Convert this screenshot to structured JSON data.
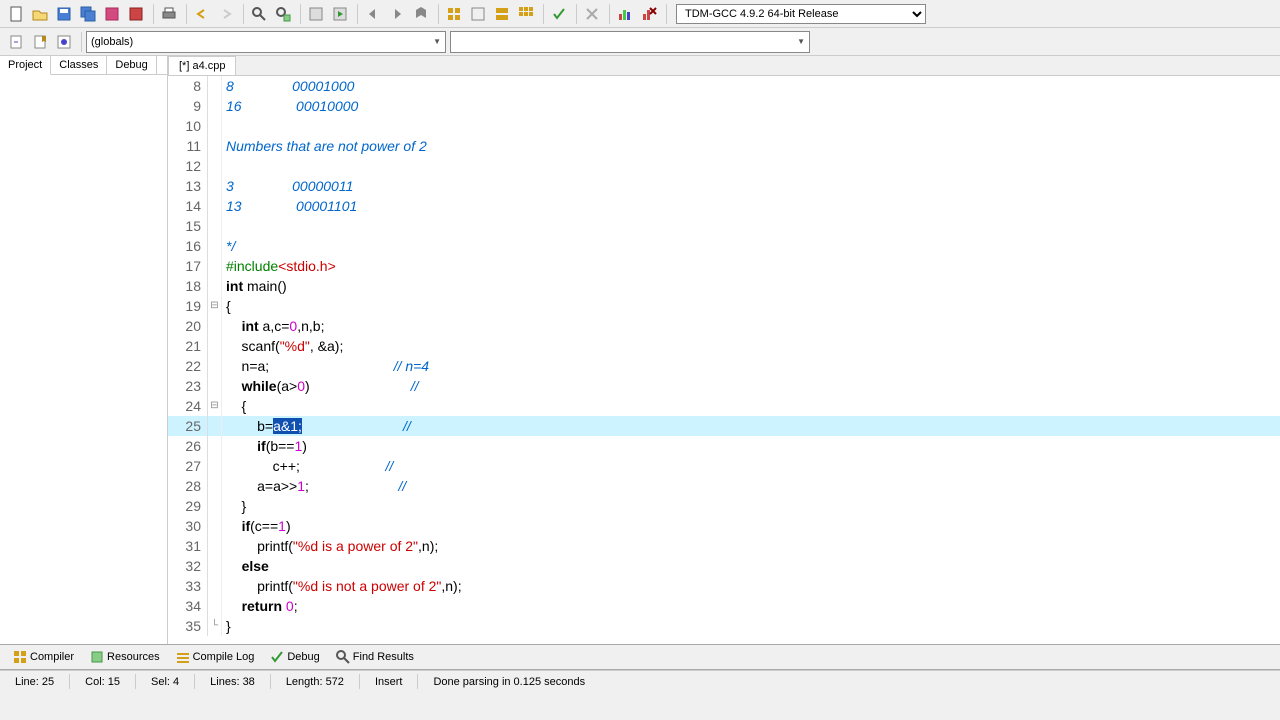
{
  "compiler_dropdown": "TDM-GCC 4.9.2 64-bit Release",
  "scope_dropdown": "(globals)",
  "side_tabs": {
    "project": "Project",
    "classes": "Classes",
    "debug": "Debug"
  },
  "file_tab": "[*] a4.cpp",
  "code_lines": [
    {
      "n": 8,
      "html": "<span class='cmt'>8               00001000</span>"
    },
    {
      "n": 9,
      "html": "<span class='cmt'>16              00010000</span>"
    },
    {
      "n": 10,
      "html": ""
    },
    {
      "n": 11,
      "html": "<span class='cmt'>Numbers that are not power of 2</span>"
    },
    {
      "n": 12,
      "html": ""
    },
    {
      "n": 13,
      "html": "<span class='cmt'>3               00000011</span>"
    },
    {
      "n": 14,
      "html": "<span class='cmt'>13              00001101</span>"
    },
    {
      "n": 15,
      "html": ""
    },
    {
      "n": 16,
      "html": "<span class='cmt'>*/</span>"
    },
    {
      "n": 17,
      "html": "<span class='pp'>#include</span><span class='str'>&lt;stdio.h&gt;</span>"
    },
    {
      "n": 18,
      "html": "<span class='kw'>int</span> <span class='fn'>main</span>()"
    },
    {
      "n": 19,
      "html": "{",
      "fold": "⊟"
    },
    {
      "n": 20,
      "html": "    <span class='kw'>int</span> a,c=<span class='num'>0</span>,n,b;"
    },
    {
      "n": 21,
      "html": "    scanf(<span class='str'>\"%d\"</span>, &a);"
    },
    {
      "n": 22,
      "html": "    n=a;                                <span class='cmt'>// n=4</span>"
    },
    {
      "n": 23,
      "html": "    <span class='kw'>while</span>(a><span class='num'>0</span>)                          <span class='cmt'>//</span>"
    },
    {
      "n": 24,
      "html": "    {",
      "fold": "⊟"
    },
    {
      "n": 25,
      "html": "        b=<span class='sel'>a&1;</span>                          <span class='cmt'>//</span>",
      "hl": true
    },
    {
      "n": 26,
      "html": "        <span class='kw'>if</span>(b==<span class='num'>1</span>)"
    },
    {
      "n": 27,
      "html": "            c++;                      <span class='cmt'>//</span>"
    },
    {
      "n": 28,
      "html": "        a=a>><span class='num'>1</span>;                       <span class='cmt'>//</span>"
    },
    {
      "n": 29,
      "html": "    }"
    },
    {
      "n": 30,
      "html": "    <span class='kw'>if</span>(c==<span class='num'>1</span>)"
    },
    {
      "n": 31,
      "html": "        printf(<span class='str'>\"%d is a power of 2\"</span>,n);"
    },
    {
      "n": 32,
      "html": "    <span class='kw'>else</span>"
    },
    {
      "n": 33,
      "html": "        printf(<span class='str'>\"%d is not a power of 2\"</span>,n);"
    },
    {
      "n": 34,
      "html": "    <span class='kw'>return</span> <span class='num'>0</span>;"
    },
    {
      "n": 35,
      "html": "}",
      "fold": "└"
    }
  ],
  "bottom_tabs": {
    "compiler": "Compiler",
    "resources": "Resources",
    "compile_log": "Compile Log",
    "debug": "Debug",
    "find": "Find Results"
  },
  "status": {
    "line": "Line:   25",
    "col": "Col:   15",
    "sel": "Sel:   4",
    "lines": "Lines:   38",
    "length": "Length:   572",
    "mode": "Insert",
    "msg": "Done parsing in 0.125 seconds"
  }
}
